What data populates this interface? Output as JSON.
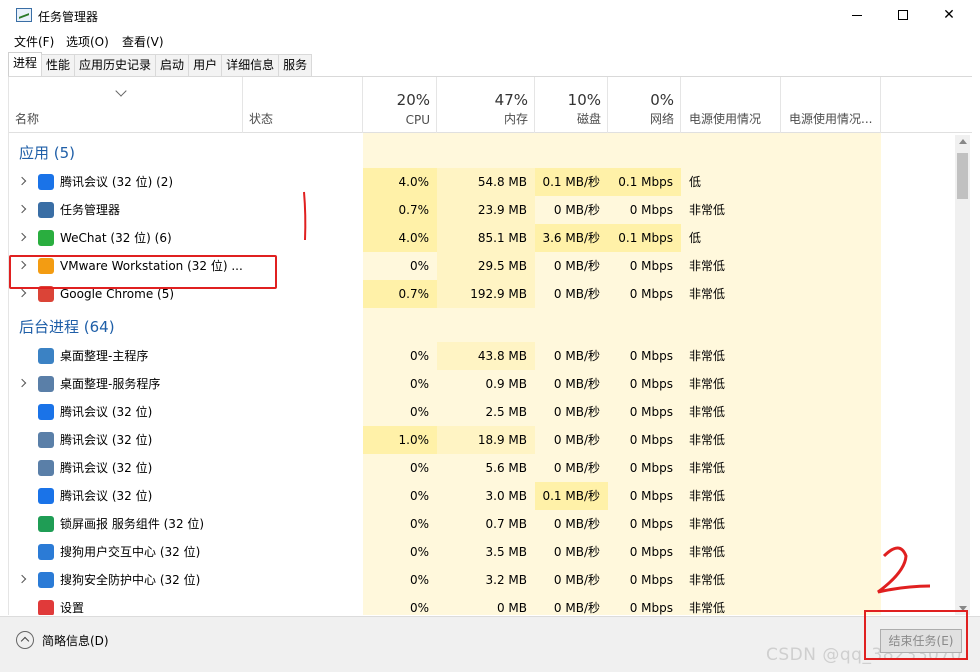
{
  "window": {
    "title": "任务管理器"
  },
  "menu": [
    "文件(F)",
    "选项(O)",
    "查看(V)"
  ],
  "tabs": [
    "进程",
    "性能",
    "应用历史记录",
    "启动",
    "用户",
    "详细信息",
    "服务"
  ],
  "columns": {
    "name": "名称",
    "status": "状态",
    "cpu": {
      "pct": "20%",
      "label": "CPU"
    },
    "memory": {
      "pct": "47%",
      "label": "内存"
    },
    "disk": {
      "pct": "10%",
      "label": "磁盘"
    },
    "network": {
      "pct": "0%",
      "label": "网络"
    },
    "power": "电源使用情况",
    "power_trend": "电源使用情况..."
  },
  "groups": {
    "apps": {
      "title": "应用 (5)"
    },
    "background": {
      "title": "后台进程 (64)"
    }
  },
  "apps": [
    {
      "name": "腾讯会议 (32 位) (2)",
      "cpu": "4.0%",
      "mem": "54.8 MB",
      "disk": "0.1 MB/秒",
      "net": "0.1 Mbps",
      "power": "低",
      "expand": true,
      "icon": "tencent-meeting-icon",
      "color": "#1a73e8"
    },
    {
      "name": "任务管理器",
      "cpu": "0.7%",
      "mem": "23.9 MB",
      "disk": "0 MB/秒",
      "net": "0 Mbps",
      "power": "非常低",
      "expand": true,
      "icon": "task-manager-icon",
      "color": "#3a6ea5"
    },
    {
      "name": "WeChat (32 位) (6)",
      "cpu": "4.0%",
      "mem": "85.1 MB",
      "disk": "3.6 MB/秒",
      "net": "0.1 Mbps",
      "power": "低",
      "expand": true,
      "icon": "wechat-icon",
      "color": "#2aae3f"
    },
    {
      "name": "VMware Workstation (32 位) ...",
      "cpu": "0%",
      "mem": "29.5 MB",
      "disk": "0 MB/秒",
      "net": "0 Mbps",
      "power": "非常低",
      "expand": true,
      "icon": "vmware-icon",
      "color": "#f39c12"
    },
    {
      "name": "Google Chrome (5)",
      "cpu": "0.7%",
      "mem": "192.9 MB",
      "disk": "0 MB/秒",
      "net": "0 Mbps",
      "power": "非常低",
      "expand": true,
      "icon": "chrome-icon",
      "color": "#db4437"
    }
  ],
  "background": [
    {
      "name": "桌面整理-主程序",
      "cpu": "0%",
      "mem": "43.8 MB",
      "disk": "0 MB/秒",
      "net": "0 Mbps",
      "power": "非常低",
      "expand": false,
      "icon": "desktop-organizer-icon",
      "color": "#3b82c4"
    },
    {
      "name": "桌面整理-服务程序",
      "cpu": "0%",
      "mem": "0.9 MB",
      "disk": "0 MB/秒",
      "net": "0 Mbps",
      "power": "非常低",
      "expand": true,
      "icon": "service-icon",
      "color": "#5a7fa8"
    },
    {
      "name": "腾讯会议 (32 位)",
      "cpu": "0%",
      "mem": "2.5 MB",
      "disk": "0 MB/秒",
      "net": "0 Mbps",
      "power": "非常低",
      "expand": false,
      "icon": "tencent-meeting-icon",
      "color": "#1a73e8"
    },
    {
      "name": "腾讯会议 (32 位)",
      "cpu": "1.0%",
      "mem": "18.9 MB",
      "disk": "0 MB/秒",
      "net": "0 Mbps",
      "power": "非常低",
      "expand": false,
      "icon": "service-icon",
      "color": "#5a7fa8"
    },
    {
      "name": "腾讯会议 (32 位)",
      "cpu": "0%",
      "mem": "5.6 MB",
      "disk": "0 MB/秒",
      "net": "0 Mbps",
      "power": "非常低",
      "expand": false,
      "icon": "service-icon",
      "color": "#5a7fa8"
    },
    {
      "name": "腾讯会议 (32 位)",
      "cpu": "0%",
      "mem": "3.0 MB",
      "disk": "0.1 MB/秒",
      "net": "0 Mbps",
      "power": "非常低",
      "expand": false,
      "icon": "tencent-meeting-icon",
      "color": "#1a73e8"
    },
    {
      "name": "锁屏画报 服务组件 (32 位)",
      "cpu": "0%",
      "mem": "0.7 MB",
      "disk": "0 MB/秒",
      "net": "0 Mbps",
      "power": "非常低",
      "expand": false,
      "icon": "lockscreen-icon",
      "color": "#1f9d55"
    },
    {
      "name": "搜狗用户交互中心 (32 位)",
      "cpu": "0%",
      "mem": "3.5 MB",
      "disk": "0 MB/秒",
      "net": "0 Mbps",
      "power": "非常低",
      "expand": false,
      "icon": "sogou-icon",
      "color": "#2b7bd6"
    },
    {
      "name": "搜狗安全防护中心 (32 位)",
      "cpu": "0%",
      "mem": "3.2 MB",
      "disk": "0 MB/秒",
      "net": "0 Mbps",
      "power": "非常低",
      "expand": true,
      "icon": "sogou-icon",
      "color": "#2b7bd6"
    },
    {
      "name": "设置",
      "cpu": "0%",
      "mem": "0 MB",
      "disk": "0 MB/秒",
      "net": "0 Mbps",
      "power": "非常低",
      "expand": false,
      "icon": "settings-icon",
      "color": "#e03a3a"
    }
  ],
  "footer": {
    "brief": "简略信息(D)",
    "end_task": "结束任务(E)",
    "watermark": "CSDN @qq_38233070"
  }
}
